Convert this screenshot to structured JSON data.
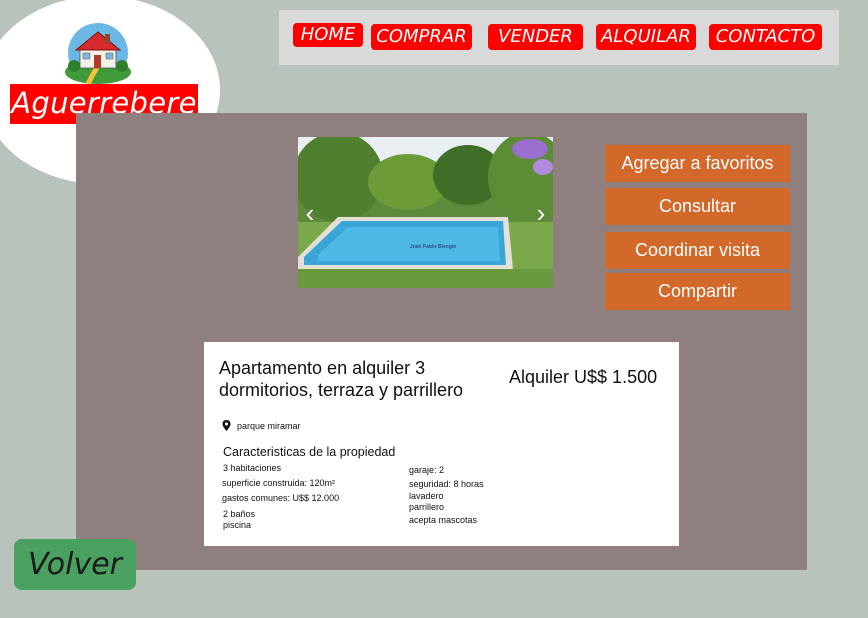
{
  "logo": {
    "text": "Aguerrebere",
    "icon": "house-icon"
  },
  "nav": {
    "home": "HOME",
    "comprar": "COMPRAR",
    "vender": "VENDER",
    "alquilar": "ALQUILAR",
    "contacto": "CONTACTO"
  },
  "carousel": {
    "prev_icon": "‹",
    "next_icon": "›",
    "watermark": "Juan Pablo Blengio",
    "image": "pool-garden-photo"
  },
  "actions": {
    "favorites": "Agregar a favoritos",
    "consult": "Consultar",
    "visit": "Coordinar visita",
    "share": "Compartir"
  },
  "listing": {
    "title": "Apartamento en alquiler 3 dormitorios, terraza y parrillero",
    "price": "Alquiler U$$ 1.500",
    "location_icon": "location-pin-icon",
    "location": "parque miramar",
    "features_heading": "Caracteristicas de la propiedad",
    "features_left": [
      "3 habitaciones",
      "superficie construida: 120m²",
      "gastos comunes: U$$ 12.000",
      "2 baños",
      "piscina"
    ],
    "features_right": [
      "garaje: 2",
      "seguridad: 8 horas",
      "lavadero",
      "parrillero",
      "acepta mascotas"
    ]
  },
  "back_button": "Volver",
  "colors": {
    "background": "#b7c3bb",
    "nav_red": "#ff0000",
    "panel": "#8f7f7e",
    "action_orange": "#d2692a",
    "back_green": "#4aa060"
  }
}
